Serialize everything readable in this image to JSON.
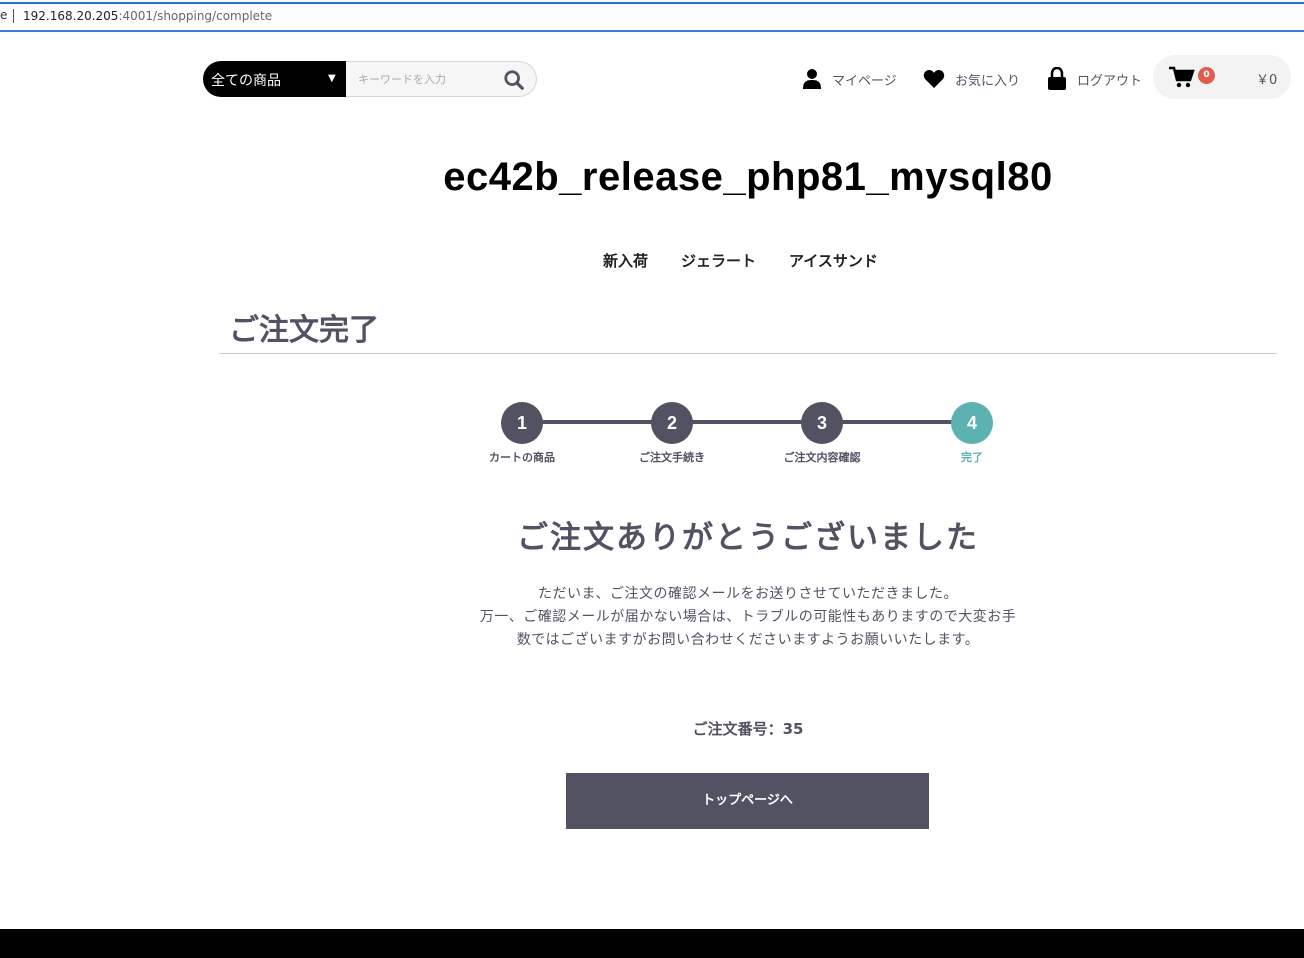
{
  "browser": {
    "prefix": "e",
    "url_host": "192.168.20.205",
    "url_path": ":4001/shopping/complete"
  },
  "header": {
    "category_select": "全ての商品",
    "search_placeholder": "キーワードを入力",
    "mypage": "マイページ",
    "favorites": "お気に入り",
    "logout": "ログアウト",
    "cart_count": "0",
    "cart_price": "￥0"
  },
  "site_title": "ec42b_release_php81_mysql80",
  "category_nav": [
    "新入荷",
    "ジェラート",
    "アイスサンド"
  ],
  "page_heading": "ご注文完了",
  "flow": {
    "steps": [
      {
        "number": "1",
        "label": "カートの商品"
      },
      {
        "number": "2",
        "label": "ご注文手続き"
      },
      {
        "number": "3",
        "label": "ご注文内容確認"
      },
      {
        "number": "4",
        "label": "完了"
      }
    ],
    "active_step": 4
  },
  "complete": {
    "title": "ご注文ありがとうございました",
    "message_line1": "ただいま、ご注文の確認メールをお送りさせていただきました。",
    "message_line2": "万一、ご確認メールが届かない場合は、トラブルの可能性もありますので大変お手数ではございますがお問い合わせくださいますようお願いいたします。",
    "order_number": "ご注文番号：35",
    "top_button": "トップページへ"
  },
  "colors": {
    "primary": "#525263",
    "active_step": "#5cb1b1",
    "badge": "#de5d50"
  }
}
